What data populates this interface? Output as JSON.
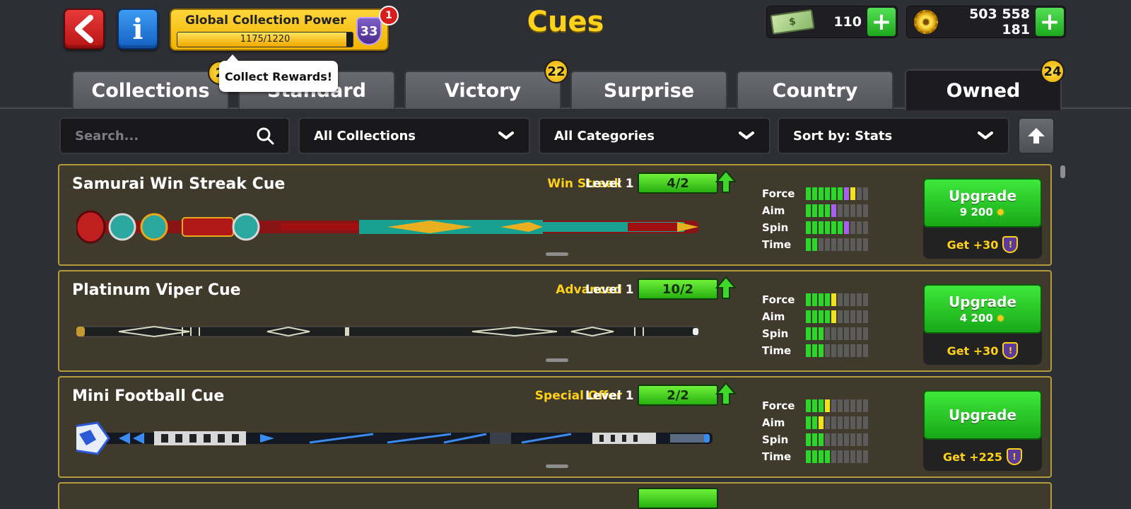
{
  "header": {
    "title": "Cues",
    "back_icon": "chevron-left-icon",
    "info_label": "i",
    "power": {
      "title": "Global Collection Power",
      "progress_text": "1175/1220",
      "current": 1175,
      "max": 1220,
      "level": "33",
      "notification_count": "1"
    },
    "cash": {
      "value": "110",
      "icon": "cash-icon"
    },
    "coins": {
      "value": "503 558 181",
      "icon": "coin-icon"
    },
    "colors": {
      "title": "#ffd21a",
      "accent_green": "#28b010"
    }
  },
  "tooltip": {
    "text": "Collect Rewards!"
  },
  "tabs": [
    {
      "label": "Collections",
      "badge": "2"
    },
    {
      "label": "Standard",
      "badge": ""
    },
    {
      "label": "Victory",
      "badge": "22"
    },
    {
      "label": "Surprise",
      "badge": ""
    },
    {
      "label": "Country",
      "badge": ""
    },
    {
      "label": "Owned",
      "badge": "24",
      "active": true
    }
  ],
  "filters": {
    "search_placeholder": "Search...",
    "collections": "All Collections",
    "categories": "All Categories",
    "sort": "Sort by: Stats"
  },
  "stat_labels": [
    "Force",
    "Aim",
    "Spin",
    "Time"
  ],
  "cues": [
    {
      "name": "Samurai Win Streak Cue",
      "category": "Win Streak",
      "level_label": "Level 1",
      "progress": "4/2",
      "stats": {
        "force": {
          "green": 6,
          "purple": 1,
          "yellow": 1,
          "total": 10
        },
        "aim": {
          "green": 4,
          "purple": 1,
          "yellow": 0,
          "total": 10
        },
        "spin": {
          "green": 6,
          "purple": 1,
          "yellow": 0,
          "total": 10
        },
        "time": {
          "green": 2,
          "purple": 0,
          "yellow": 0,
          "total": 10
        }
      },
      "upgrade_label": "Upgrade",
      "upgrade_cost": "9 200",
      "get_label": "Get +30"
    },
    {
      "name": "Platinum Viper Cue",
      "category": "Advanced",
      "level_label": "Level 1",
      "progress": "10/2",
      "stats": {
        "force": {
          "green": 4,
          "purple": 0,
          "yellow": 1,
          "total": 10
        },
        "aim": {
          "green": 4,
          "purple": 0,
          "yellow": 1,
          "total": 10
        },
        "spin": {
          "green": 3,
          "purple": 0,
          "yellow": 0,
          "total": 10
        },
        "time": {
          "green": 3,
          "purple": 0,
          "yellow": 0,
          "total": 10
        }
      },
      "upgrade_label": "Upgrade",
      "upgrade_cost": "4 200",
      "get_label": "Get +30"
    },
    {
      "name": "Mini Football Cue",
      "category": "Special Offer",
      "level_label": "Level 1",
      "progress": "2/2",
      "stats": {
        "force": {
          "green": 3,
          "purple": 0,
          "yellow": 1,
          "total": 10
        },
        "aim": {
          "green": 2,
          "purple": 0,
          "yellow": 1,
          "total": 10
        },
        "spin": {
          "green": 3,
          "purple": 0,
          "yellow": 0,
          "total": 10
        },
        "time": {
          "green": 4,
          "purple": 0,
          "yellow": 0,
          "total": 10
        }
      },
      "upgrade_label": "Upgrade",
      "upgrade_cost": "",
      "get_label": "Get +225"
    }
  ]
}
